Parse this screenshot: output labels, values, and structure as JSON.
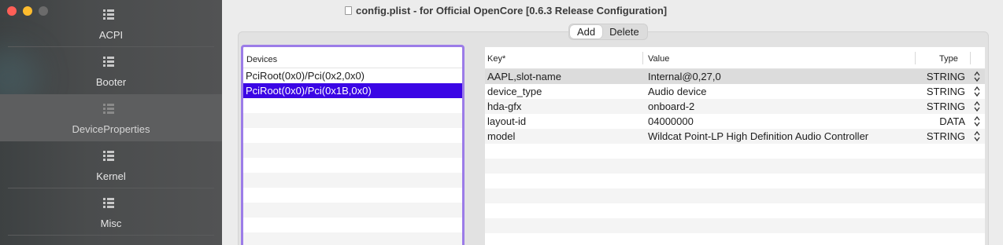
{
  "sidebar": {
    "items": [
      {
        "label": "ACPI",
        "selected": false
      },
      {
        "label": "Booter",
        "selected": false
      },
      {
        "label": "DeviceProperties",
        "selected": true
      },
      {
        "label": "Kernel",
        "selected": false
      },
      {
        "label": "Misc",
        "selected": false
      }
    ]
  },
  "window": {
    "title": "config.plist - for Official OpenCore [0.6.3 Release Configuration]"
  },
  "toolbar": {
    "add_label": "Add",
    "delete_label": "Delete"
  },
  "devices": {
    "header": "Devices",
    "rows": [
      "PciRoot(0x0)/Pci(0x2,0x0)",
      "PciRoot(0x0)/Pci(0x1B,0x0)"
    ],
    "selected_index": 1
  },
  "properties": {
    "headers": {
      "key": "Key*",
      "value": "Value",
      "type": "Type"
    },
    "rows": [
      {
        "key": "AAPL,slot-name",
        "value": "Internal@0,27,0",
        "type": "STRING"
      },
      {
        "key": "device_type",
        "value": "Audio device",
        "type": "STRING"
      },
      {
        "key": "hda-gfx",
        "value": "onboard-2",
        "type": "STRING"
      },
      {
        "key": "layout-id",
        "value": "04000000",
        "type": "DATA"
      },
      {
        "key": "model",
        "value": "Wildcat Point-LP High Definition Audio Controller",
        "type": "STRING"
      }
    ]
  },
  "colors": {
    "selection": "#3b06e5",
    "focus_ring": "#9c7ce8"
  }
}
